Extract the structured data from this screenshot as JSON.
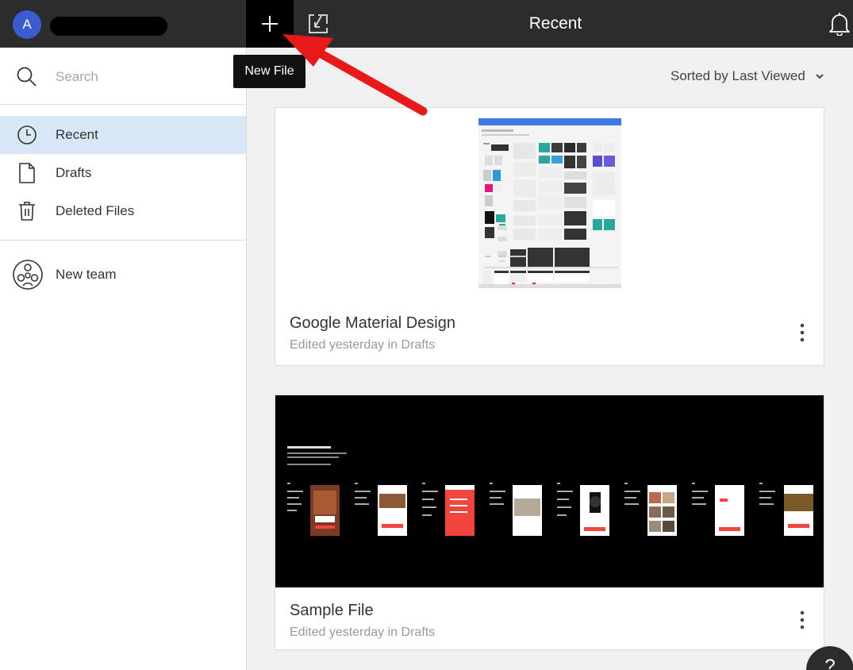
{
  "header": {
    "avatar_initial": "A",
    "title": "Recent",
    "new_file_icon": "plus-icon",
    "import_icon": "import-icon",
    "notifications_icon": "bell-icon"
  },
  "tooltip": {
    "text": "New File"
  },
  "sidebar": {
    "search": {
      "placeholder": "Search",
      "icon": "search-icon"
    },
    "items": [
      {
        "label": "Recent",
        "icon": "clock-icon",
        "active": true
      },
      {
        "label": "Drafts",
        "icon": "file-icon",
        "active": false
      },
      {
        "label": "Deleted Files",
        "icon": "trash-icon",
        "active": false
      }
    ],
    "team": {
      "label": "New team",
      "icon": "team-icon"
    }
  },
  "main": {
    "sort_label": "Sorted by Last Viewed",
    "files": [
      {
        "title": "Google Material Design",
        "meta": "Edited yesterday in Drafts"
      },
      {
        "title": "Sample File",
        "meta": "Edited yesterday in Drafts"
      }
    ]
  },
  "help": {
    "label": "?"
  },
  "colors": {
    "topbar": "#2c2c2c",
    "avatar": "#3d5bd0",
    "active_nav": "#d7e7f6",
    "annotation": "#e8191b",
    "sample_accent": "#f1453d"
  }
}
